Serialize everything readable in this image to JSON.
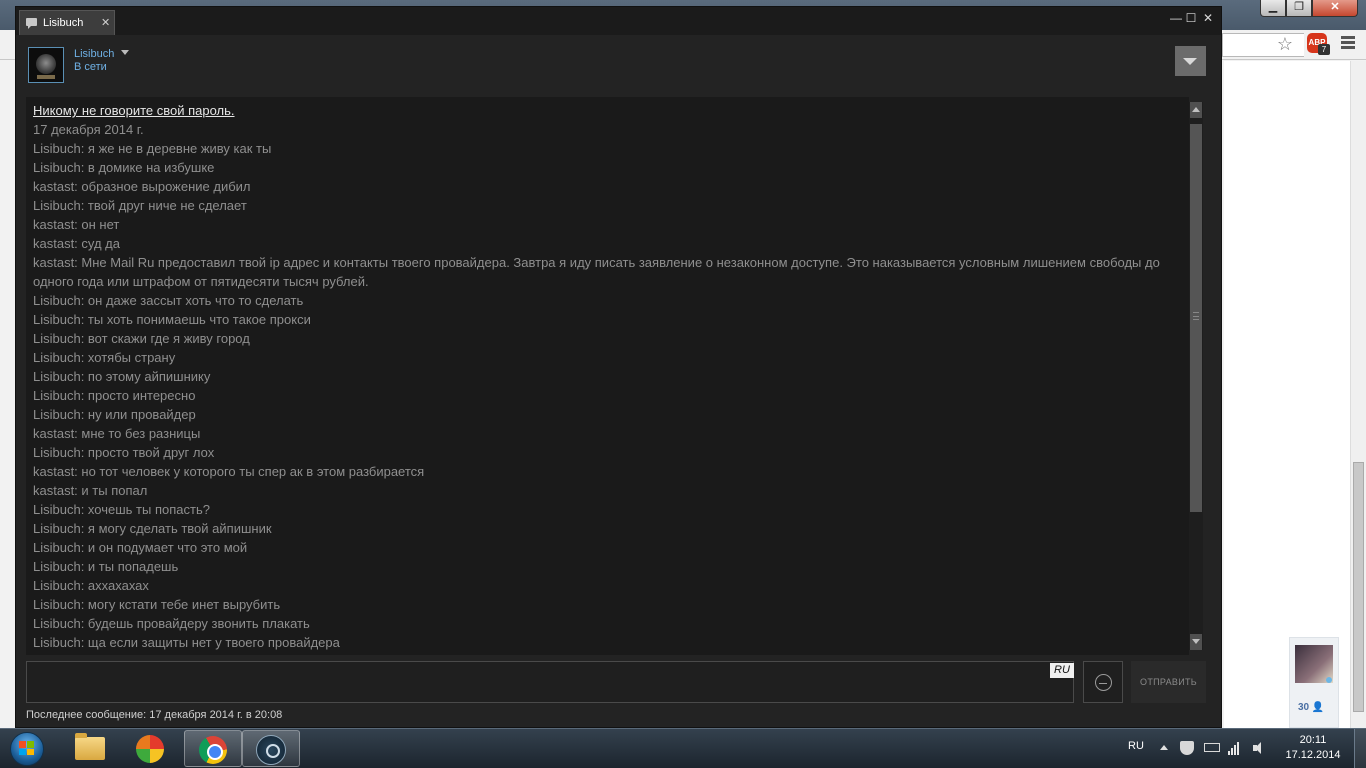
{
  "chat": {
    "tab_title": "Lisibuch",
    "user_name": "Lisibuch",
    "user_status": "В сети",
    "warning": "Никому не говорите свой пароль.",
    "date": "17 декабря 2014 г.",
    "messages": [
      "Lisibuch: я же не в деревне живу как ты",
      "Lisibuch: в домике на избушке",
      "kastast: образное вырожение дибил",
      "Lisibuch: твой друг ниче не сделает",
      "kastast: он нет",
      "kastast: суд да",
      "kastast: Мне Mail Ru предоставил твой ip адрес и контакты твоего провайдера. Завтра я иду писать заявление о незаконном доступе. Это наказывается условным лишением свободы до одного года или штрафом от пятидесяти тысяч рублей.",
      "Lisibuch: он даже зассыт хоть что то сделать",
      "Lisibuch: ты хоть понимаешь что такое прокси",
      "Lisibuch: вот скажи где я живу город",
      "Lisibuch: хотябы страну",
      "Lisibuch: по этому айпишнику",
      "Lisibuch: просто интересно",
      "Lisibuch: ну или провайдер",
      "kastast: мне то без разницы",
      "Lisibuch: просто твой друг лох",
      "kastast: но тот человек у которого ты спер ак в этом разбирается",
      "kastast: и ты попал",
      "Lisibuch: хочешь ты попасть?",
      "Lisibuch: я могу сделать твой айпишник",
      "Lisibuch: и он подумает что это мой",
      "Lisibuch: и ты попадешь",
      "Lisibuch: аххахахах",
      "Lisibuch: могу кстати тебе инет вырубить",
      "Lisibuch: будешь провайдеру звонить плакать",
      "Lisibuch: ща если защиты нет у твоего провайдера"
    ],
    "input_lang": "RU",
    "send_label": "ОТПРАВИТЬ",
    "last_message": "Последнее сообщение: 17 декабря 2014 г. в 20:08",
    "icons": {
      "tab": "chat-bubble-icon",
      "menu": "chevron-down-icon",
      "emoticon": "smiley-icon"
    }
  },
  "browser": {
    "abp_label": "ABP",
    "abp_count": "7",
    "friend_count": "30 👤"
  },
  "taskbar": {
    "lang": "RU",
    "time": "20:11",
    "date": "17.12.2014"
  },
  "colors": {
    "chat_bg": "#232323",
    "chat_log_bg": "#1a1a1a",
    "link_blue": "#6fb0e4",
    "message_text": "#8f8f8f"
  }
}
